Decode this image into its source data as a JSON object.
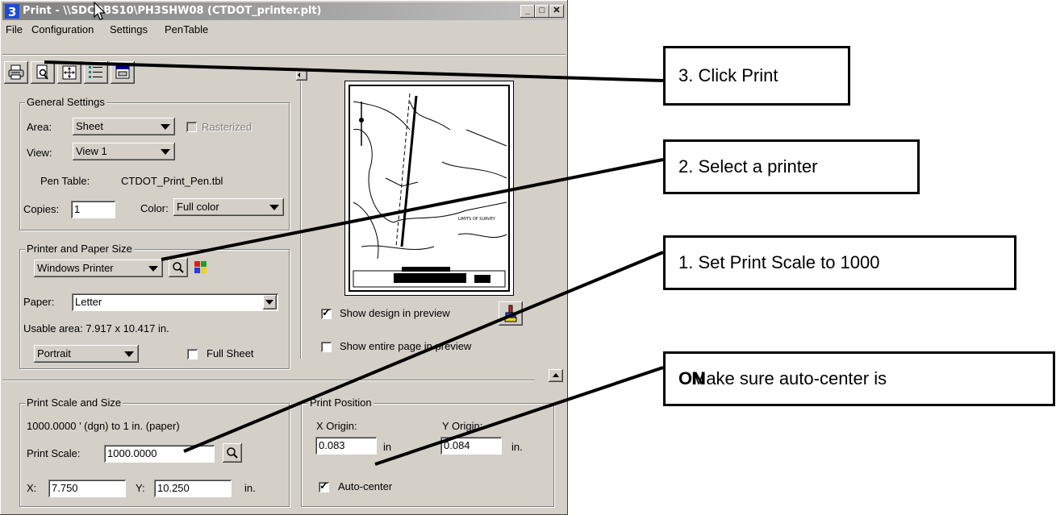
{
  "window": {
    "title": "Print - \\\\SDCDBS10\\PH3SHW08  (CTDOT_printer.plt)",
    "controls": {
      "minimize": "_",
      "maximize": "□",
      "close": "✕"
    }
  },
  "menu": [
    "File",
    "Configuration",
    "Settings",
    "PenTable"
  ],
  "toolbar": {
    "icons": [
      "printer-icon",
      "preview-icon",
      "fit-icon",
      "list-icon",
      "driver-icon"
    ]
  },
  "general": {
    "legend": "General Settings",
    "area_label": "Area:",
    "area_value": "Sheet",
    "rasterized_label": "Rasterized",
    "view_label": "View:",
    "view_value": "View 1",
    "pen_table_label": "Pen Table:",
    "pen_table_value": "CTDOT_Print_Pen.tbl",
    "copies_label": "Copies:",
    "copies_value": "1",
    "color_label": "Color:",
    "color_value": "Full color"
  },
  "printer": {
    "legend": "Printer and Paper Size",
    "printer_value": "Windows Printer",
    "paper_label": "Paper:",
    "paper_value": "Letter",
    "usable_area": "Usable area:  7.917 x 10.417 in.",
    "orientation_value": "Portrait",
    "full_sheet_label": "Full Sheet"
  },
  "preview": {
    "show_design_label": "Show design in preview",
    "show_design_checked": true,
    "show_entire_label": "Show entire page in preview",
    "show_entire_checked": false
  },
  "scale": {
    "legend": "Print Scale and Size",
    "ratio_text": "1000.0000 ' (dgn) to 1 in. (paper)",
    "scale_label": "Print Scale:",
    "scale_value": "1000.0000",
    "x_label": "X:",
    "x_value": "7.750",
    "y_label": "Y:",
    "y_value": "10.250",
    "unit": "in."
  },
  "position": {
    "legend": "Print Position",
    "x_origin_label": "X Origin:",
    "x_origin_value": "0.083",
    "y_origin_label": "Y Origin:",
    "y_origin_value": "0.084",
    "unit": "in",
    "unit_y": "in.",
    "auto_center_label": "Auto-center",
    "auto_center_checked": true
  },
  "callouts": {
    "c3": "3. Click Print",
    "c2": "2. Select a printer",
    "c1": "1. Set Print Scale to 1000",
    "c4_prefix": "Make sure auto-center is ",
    "c4_bold": "ON"
  }
}
